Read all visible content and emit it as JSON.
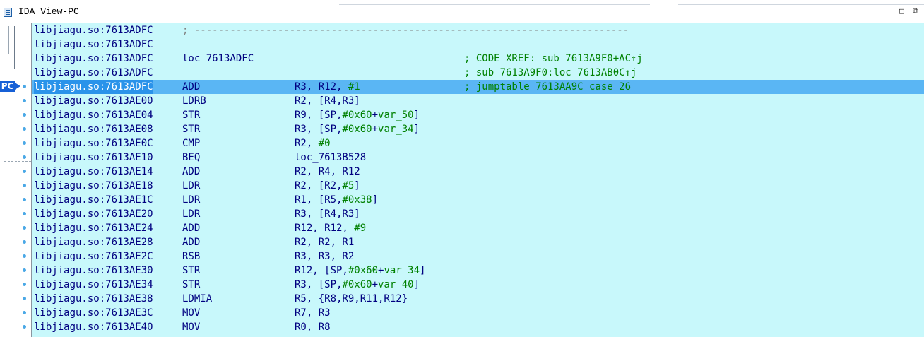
{
  "window": {
    "title": "IDA View-PC",
    "maximize_glyph": "□",
    "restore_glyph": "⧉"
  },
  "listing": {
    "pc_badge": "PC",
    "lines": [
      {
        "addr": "libjiagu.so:7613ADFC",
        "sep": "; -------------------------------------------------------------------------"
      },
      {
        "addr": "libjiagu.so:7613ADFC"
      },
      {
        "addr": "libjiagu.so:7613ADFC",
        "label": "loc_7613ADFC",
        "comment": "; CODE XREF: sub_7613A9F0+AC↑j"
      },
      {
        "addr": "libjiagu.so:7613ADFC",
        "comment": "; sub_7613A9F0:loc_7613AB0C↑j"
      },
      {
        "addr": "libjiagu.so:7613ADFC",
        "mnem": "ADD",
        "ops": "R3, R12, ",
        "num": "#1",
        "comment": "; jumptable 7613AA9C case 26",
        "current": true
      },
      {
        "addr": "libjiagu.so:7613AE00",
        "mnem": "LDRB",
        "ops": "R2, [R4,R3]"
      },
      {
        "addr": "libjiagu.so:7613AE04",
        "mnem": "STR",
        "ops": "R9, [SP,",
        "num": "#0x60",
        "ops2": "+",
        "var": "var_50",
        "ops3": "]"
      },
      {
        "addr": "libjiagu.so:7613AE08",
        "mnem": "STR",
        "ops": "R3, [SP,",
        "num": "#0x60",
        "ops2": "+",
        "var": "var_34",
        "ops3": "]"
      },
      {
        "addr": "libjiagu.so:7613AE0C",
        "mnem": "CMP",
        "ops": "R2, ",
        "num": "#0"
      },
      {
        "addr": "libjiagu.so:7613AE10",
        "mnem": "BEQ",
        "ops": "loc_7613B528"
      },
      {
        "addr": "libjiagu.so:7613AE14",
        "mnem": "ADD",
        "ops": "R2, R4, R12"
      },
      {
        "addr": "libjiagu.so:7613AE18",
        "mnem": "LDR",
        "ops": "R2, [R2,",
        "num": "#5",
        "ops2": "]"
      },
      {
        "addr": "libjiagu.so:7613AE1C",
        "mnem": "LDR",
        "ops": "R1, [R5,",
        "num": "#0x38",
        "ops2": "]"
      },
      {
        "addr": "libjiagu.so:7613AE20",
        "mnem": "LDR",
        "ops": "R3, [R4,R3]"
      },
      {
        "addr": "libjiagu.so:7613AE24",
        "mnem": "ADD",
        "ops": "R12, R12, ",
        "num": "#9"
      },
      {
        "addr": "libjiagu.so:7613AE28",
        "mnem": "ADD",
        "ops": "R2, R2, R1"
      },
      {
        "addr": "libjiagu.so:7613AE2C",
        "mnem": "RSB",
        "ops": "R3, R3, R2"
      },
      {
        "addr": "libjiagu.so:7613AE30",
        "mnem": "STR",
        "ops": "R12, [SP,",
        "num": "#0x60",
        "ops2": "+",
        "var": "var_34",
        "ops3": "]"
      },
      {
        "addr": "libjiagu.so:7613AE34",
        "mnem": "STR",
        "ops": "R3, [SP,",
        "num": "#0x60",
        "ops2": "+",
        "var": "var_40",
        "ops3": "]"
      },
      {
        "addr": "libjiagu.so:7613AE38",
        "mnem": "LDMIA",
        "ops": "R5, {R8,R9,R11,R12}"
      },
      {
        "addr": "libjiagu.so:7613AE3C",
        "mnem": "MOV",
        "ops": "R7, R3"
      },
      {
        "addr": "libjiagu.so:7613AE40",
        "mnem": "MOV",
        "ops": "R0, R8"
      }
    ]
  },
  "colors": {
    "background": "#c8f8fb",
    "current_line": "#5ab6f4",
    "instruction_text": "#000080",
    "comment_text": "#008000"
  }
}
